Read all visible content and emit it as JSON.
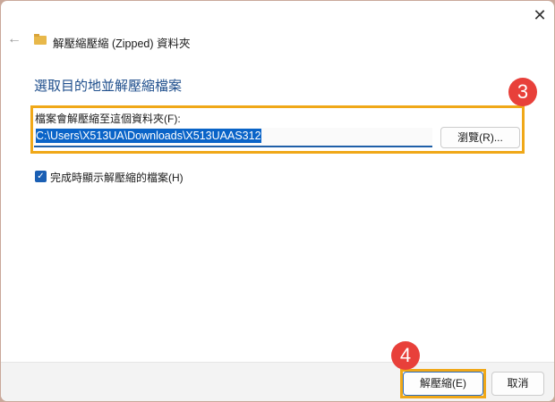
{
  "window": {
    "title": "解壓縮壓縮 (Zipped) 資料夾",
    "close": "✕",
    "back": "←"
  },
  "heading": "選取目的地並解壓縮檔案",
  "dest_label": "檔案會解壓縮至這個資料夾(F):",
  "dest_value": "C:\\Users\\X513UA\\Downloads\\X513UAAS312",
  "browse": "瀏覽(R)...",
  "checkbox": {
    "label": "完成時顯示解壓縮的檔案(H)",
    "checked": true,
    "mark": "✓"
  },
  "buttons": {
    "extract": "解壓縮(E)",
    "cancel": "取消"
  },
  "annotations": {
    "step3": "3",
    "step4": "4"
  }
}
